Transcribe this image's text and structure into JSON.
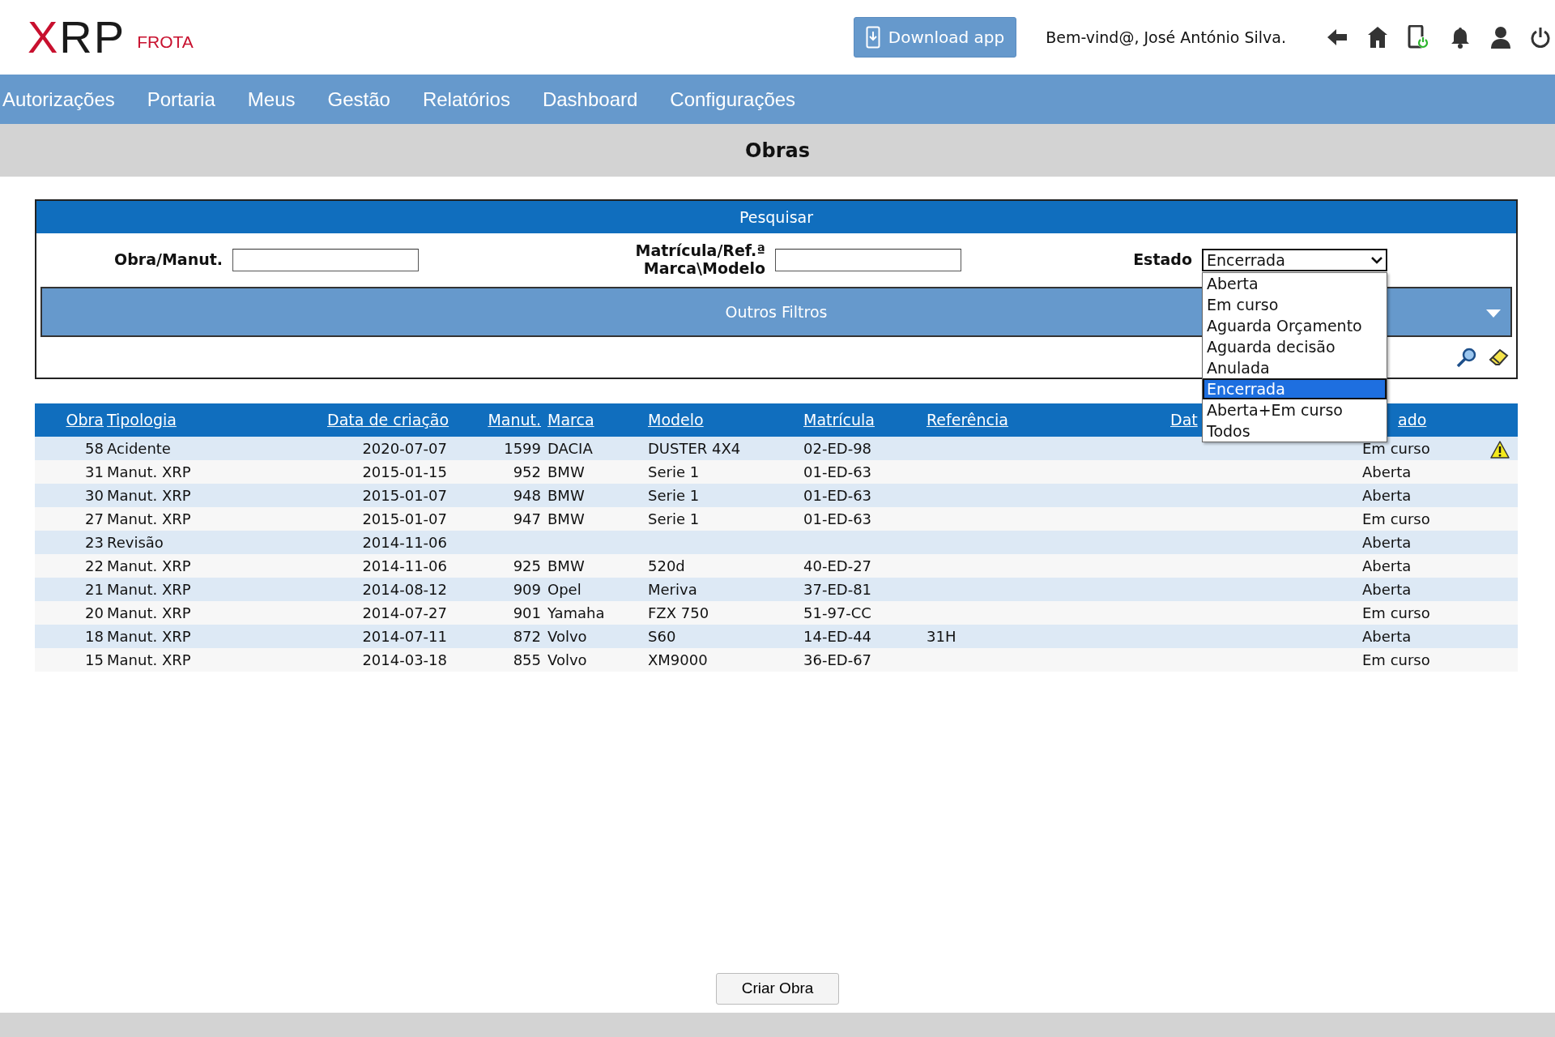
{
  "header": {
    "logo": [
      {
        "text": "X",
        "color": "#c8102e"
      },
      {
        "text": "RP",
        "color": "#1a1a1a"
      }
    ],
    "logo_subtitle": "FROTA",
    "download_button": "Download app",
    "welcome": "Bem-vind@, José António Silva."
  },
  "nav": [
    {
      "label": "Autorizações"
    },
    {
      "label": "Portaria"
    },
    {
      "label": "Meus"
    },
    {
      "label": "Gestão"
    },
    {
      "label": "Relatórios"
    },
    {
      "label": "Dashboard"
    },
    {
      "label": "Configurações"
    }
  ],
  "page_title": "Obras",
  "search": {
    "title": "Pesquisar",
    "fields": [
      {
        "label_lines": [
          "Obra/Manut."
        ]
      },
      {
        "label_lines": [
          "Matrícula/Ref.ª",
          "Marca\\Modelo"
        ]
      }
    ],
    "estado": {
      "label": "Estado",
      "value": "Encerrada",
      "expanded": true,
      "options": [
        {
          "label": "Aberta",
          "selected": false
        },
        {
          "label": "Em curso",
          "selected": false
        },
        {
          "label": "Aguarda Orçamento",
          "selected": false
        },
        {
          "label": "Aguarda decisão",
          "selected": false
        },
        {
          "label": "Anulada",
          "selected": false
        },
        {
          "label": "Encerrada",
          "selected": true
        },
        {
          "label": "Aberta+Em curso",
          "selected": false
        },
        {
          "label": "Todos",
          "selected": false
        }
      ]
    },
    "other_filters": "Outros Filtros"
  },
  "table": {
    "columns": [
      {
        "label": "Obra"
      },
      {
        "label": "Tipologia"
      },
      {
        "label": "Data de criação"
      },
      {
        "label": "Manut."
      },
      {
        "label": "Marca"
      },
      {
        "label": "Modelo"
      },
      {
        "label": "Matrícula"
      },
      {
        "label": "Referência"
      },
      {
        "label": "Dat"
      },
      {
        "label": "ado"
      }
    ],
    "rows": [
      {
        "obra": "58",
        "tipologia": "Acidente",
        "data": "2020-07-07",
        "manut": "1599",
        "marca": "DACIA",
        "modelo": "DUSTER 4X4",
        "matricula": "02-ED-98",
        "estado": "Em curso",
        "warning": true
      },
      {
        "obra": "31",
        "tipologia": "Manut. XRP",
        "data": "2015-01-15",
        "manut": "952",
        "marca": "BMW",
        "modelo": "Serie 1",
        "matricula": "01-ED-63",
        "estado": "Aberta",
        "warning": false
      },
      {
        "obra": "30",
        "tipologia": "Manut. XRP",
        "data": "2015-01-07",
        "manut": "948",
        "marca": "BMW",
        "modelo": "Serie 1",
        "matricula": "01-ED-63",
        "estado": "Aberta",
        "warning": false
      },
      {
        "obra": "27",
        "tipologia": "Manut. XRP",
        "data": "2015-01-07",
        "manut": "947",
        "marca": "BMW",
        "modelo": "Serie 1",
        "matricula": "01-ED-63",
        "estado": "Em curso",
        "warning": false
      },
      {
        "obra": "23",
        "tipologia": "Revisão",
        "data": "2014-11-06",
        "estado": "Aberta",
        "warning": false
      },
      {
        "obra": "22",
        "tipologia": "Manut. XRP",
        "data": "2014-11-06",
        "manut": "925",
        "marca": "BMW",
        "modelo": "520d",
        "matricula": "40-ED-27",
        "estado": "Aberta",
        "warning": false
      },
      {
        "obra": "21",
        "tipologia": "Manut. XRP",
        "data": "2014-08-12",
        "manut": "909",
        "marca": "Opel",
        "modelo": "Meriva",
        "matricula": "37-ED-81",
        "estado": "Aberta",
        "warning": false
      },
      {
        "obra": "20",
        "tipologia": "Manut. XRP",
        "data": "2014-07-27",
        "manut": "901",
        "marca": "Yamaha",
        "modelo": "FZX 750",
        "matricula": "51-97-CC",
        "estado": "Em curso",
        "warning": false
      },
      {
        "obra": "18",
        "tipologia": "Manut. XRP",
        "data": "2014-07-11",
        "manut": "872",
        "marca": "Volvo",
        "modelo": "S60",
        "matricula": "14-ED-44",
        "referencia": "31H",
        "estado": "Aberta",
        "warning": false
      },
      {
        "obra": "15",
        "tipologia": "Manut. XRP",
        "data": "2014-03-18",
        "manut": "855",
        "marca": "Volvo",
        "modelo": "XM9000",
        "matricula": "36-ED-67",
        "estado": "Em curso",
        "warning": false
      }
    ]
  },
  "create_button": "Criar Obra"
}
